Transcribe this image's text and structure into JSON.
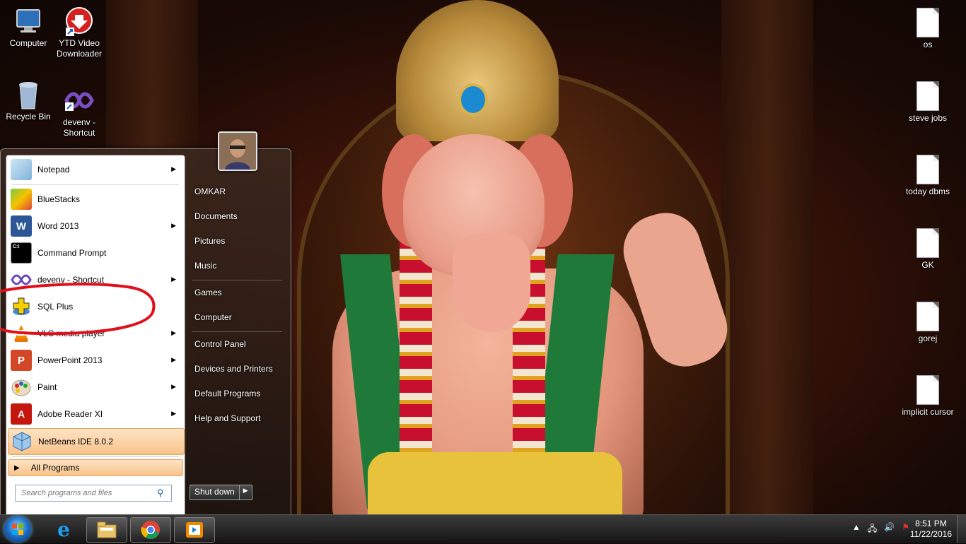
{
  "desktop": {
    "icons_left": [
      {
        "label": "Computer",
        "icon": "computer-icon"
      },
      {
        "label": "YTD Video Downloader",
        "icon": "ytd-downloader-icon"
      },
      {
        "label": "Recycle Bin",
        "icon": "recycle-bin-icon"
      },
      {
        "label": "devenv - Shortcut",
        "icon": "visual-studio-icon"
      }
    ],
    "icons_right": [
      {
        "label": "os"
      },
      {
        "label": "steve jobs"
      },
      {
        "label": "today dbms"
      },
      {
        "label": "GK"
      },
      {
        "label": "gorej"
      },
      {
        "label": "implicit cursor"
      }
    ]
  },
  "start_menu": {
    "programs": [
      {
        "label": "Notepad",
        "icon": "notepad-icon",
        "has_submenu": true
      },
      {
        "label": "BlueStacks",
        "icon": "bluestacks-icon",
        "has_submenu": false
      },
      {
        "label": "Word 2013",
        "icon": "word-icon",
        "has_submenu": true
      },
      {
        "label": "Command Prompt",
        "icon": "cmd-icon",
        "has_submenu": false
      },
      {
        "label": "devenv - Shortcut",
        "icon": "visual-studio-icon",
        "has_submenu": true
      },
      {
        "label": "SQL Plus",
        "icon": "sqlplus-icon",
        "has_submenu": false
      },
      {
        "label": "VLC media player",
        "icon": "vlc-icon",
        "has_submenu": true
      },
      {
        "label": "PowerPoint 2013",
        "icon": "powerpoint-icon",
        "has_submenu": true
      },
      {
        "label": "Paint",
        "icon": "paint-icon",
        "has_submenu": true
      },
      {
        "label": "Adobe Reader XI",
        "icon": "adobe-reader-icon",
        "has_submenu": true
      },
      {
        "label": "NetBeans IDE 8.0.2",
        "icon": "netbeans-icon",
        "has_submenu": false,
        "highlighted": true
      }
    ],
    "all_programs": "All Programs",
    "search_placeholder": "Search programs and files",
    "right_pane": {
      "user": "OMKAR",
      "documents": "Documents",
      "pictures": "Pictures",
      "music": "Music",
      "games": "Games",
      "computer": "Computer",
      "control_panel": "Control Panel",
      "devices": "Devices and Printers",
      "default_programs": "Default Programs",
      "help": "Help and Support"
    },
    "shutdown": "Shut down"
  },
  "taskbar": {
    "pinned": [
      "internet-explorer-icon",
      "file-explorer-icon",
      "chrome-icon",
      "media-player-icon"
    ],
    "time": "8:51 PM",
    "date": "11/22/2016"
  },
  "colors": {
    "annotation": "#e0101a",
    "highlight": "#f9c38a"
  }
}
